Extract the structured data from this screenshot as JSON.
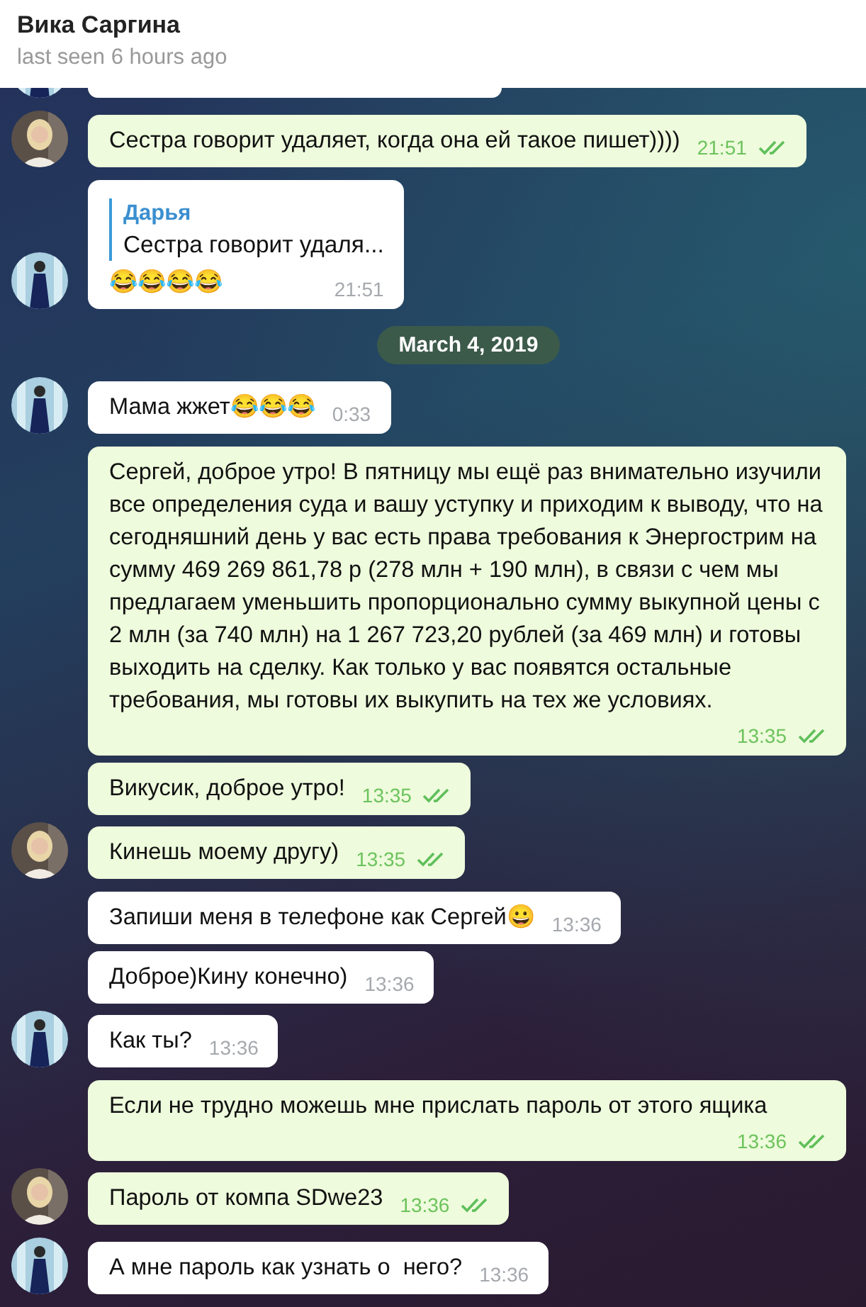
{
  "header": {
    "title": "Вика Саргина",
    "status": "last seen 6 hours ago"
  },
  "messages": [
    {
      "kind": "message",
      "outgoing": false,
      "clipped": true,
      "avatar": true
    },
    {
      "kind": "message",
      "outgoing": true,
      "text": "Сестра говорит удаляет, когда она ей такое пишет))))",
      "time": "21:51",
      "read": true,
      "avatar": true
    },
    {
      "kind": "message",
      "outgoing": false,
      "reply": {
        "author": "Дарья",
        "text": "Сестра говорит удаля..."
      },
      "text": "😂😂😂😂",
      "time": "21:51",
      "avatar": true
    },
    {
      "kind": "date",
      "text": "March 4, 2019"
    },
    {
      "kind": "message",
      "outgoing": false,
      "text": "Мама жжет😂😂😂",
      "time": "0:33",
      "avatar": true
    },
    {
      "kind": "message",
      "outgoing": true,
      "text": "Сергей, доброе утро! В пятницу мы ещё раз внимательно изучили все определения суда и вашу уступку и приходим к выводу, что на сегодняшний день у вас есть права требования к Энергострим на сумму 469 269 861,78 р (278 млн + 190 млн), в связи с чем мы предлагаем уменьшить пропорционально сумму выкупной цены с 2 млн (за 740 млн) на 1 267 723,20 рублей (за 469 млн) и готовы выходить на сделку. Как только у вас появятся остальные требования, мы готовы их выкупить на тех же условиях.",
      "time": "13:35",
      "read": true,
      "avatar": false
    },
    {
      "kind": "message",
      "outgoing": true,
      "text": "Викусик, доброе утро!",
      "time": "13:35",
      "read": true,
      "avatar": false
    },
    {
      "kind": "message",
      "outgoing": true,
      "text": "Кинешь моему другу)",
      "time": "13:35",
      "read": true,
      "avatar": true
    },
    {
      "kind": "message",
      "outgoing": false,
      "text": "Запиши меня в телефоне как Сергей😀",
      "time": "13:36",
      "avatar": false
    },
    {
      "kind": "message",
      "outgoing": false,
      "text": "Доброе)Кину конечно)",
      "time": "13:36",
      "avatar": false
    },
    {
      "kind": "message",
      "outgoing": false,
      "text": "Как ты?",
      "time": "13:36",
      "avatar": true
    },
    {
      "kind": "message",
      "outgoing": true,
      "text": "Если не трудно можешь мне прислать пароль от этого ящика",
      "time": "13:36",
      "read": true,
      "avatar": false
    },
    {
      "kind": "message",
      "outgoing": true,
      "text": "Пароль от компа SDwe23",
      "time": "13:36",
      "read": true,
      "avatar": true
    },
    {
      "kind": "message",
      "outgoing": false,
      "text": "А мне пароль как узнать о  него?",
      "time": "13:36",
      "avatar": true
    }
  ]
}
